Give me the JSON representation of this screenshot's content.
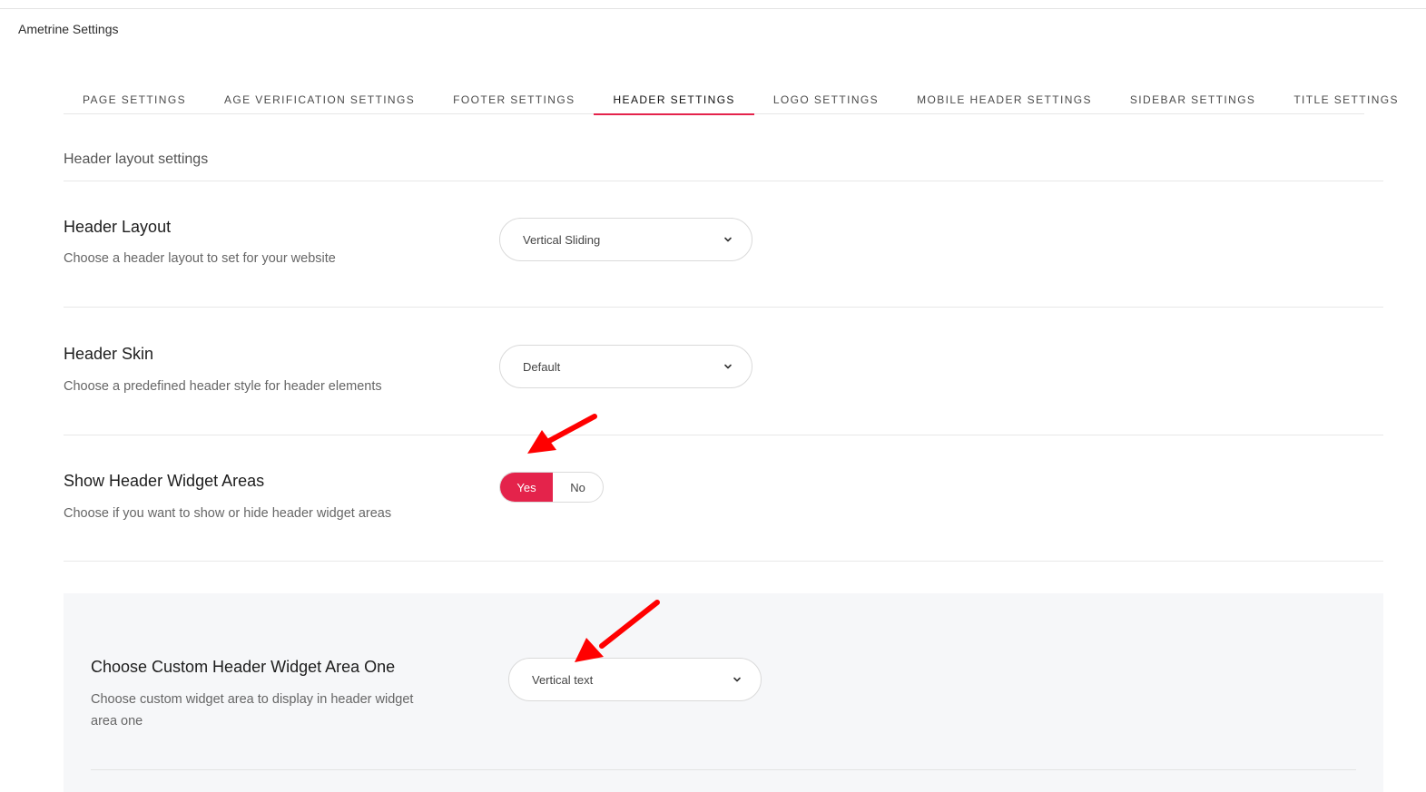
{
  "app": {
    "title": "Ametrine Settings"
  },
  "tabs": [
    {
      "label": "PAGE SETTINGS",
      "active": false
    },
    {
      "label": "AGE VERIFICATION SETTINGS",
      "active": false
    },
    {
      "label": "FOOTER SETTINGS",
      "active": false
    },
    {
      "label": "HEADER SETTINGS",
      "active": true
    },
    {
      "label": "LOGO SETTINGS",
      "active": false
    },
    {
      "label": "MOBILE HEADER SETTINGS",
      "active": false
    },
    {
      "label": "SIDEBAR SETTINGS",
      "active": false
    },
    {
      "label": "TITLE SETTINGS",
      "active": false
    }
  ],
  "section": {
    "title": "Header layout settings"
  },
  "header_layout": {
    "label": "Header Layout",
    "description": "Choose a header layout to set for your website",
    "value": "Vertical Sliding"
  },
  "header_skin": {
    "label": "Header Skin",
    "description": "Choose a predefined header style for header elements",
    "value": "Default"
  },
  "widget_areas": {
    "label": "Show Header Widget Areas",
    "description": "Choose if you want to show or hide header widget areas",
    "yes_label": "Yes",
    "no_label": "No",
    "selected": "Yes"
  },
  "custom_widget_one": {
    "label": "Choose Custom Header Widget Area One",
    "description_line1": "Choose custom widget area to display in header widget",
    "description_line2": "area one",
    "value": "Vertical text"
  },
  "colors": {
    "accent": "#e4234b",
    "annotation_arrow": "#ff0000",
    "panel_background": "#f6f7f9"
  },
  "icons": {
    "select_caret": "chevron-down-icon",
    "annotation": "red-arrow-icon"
  }
}
